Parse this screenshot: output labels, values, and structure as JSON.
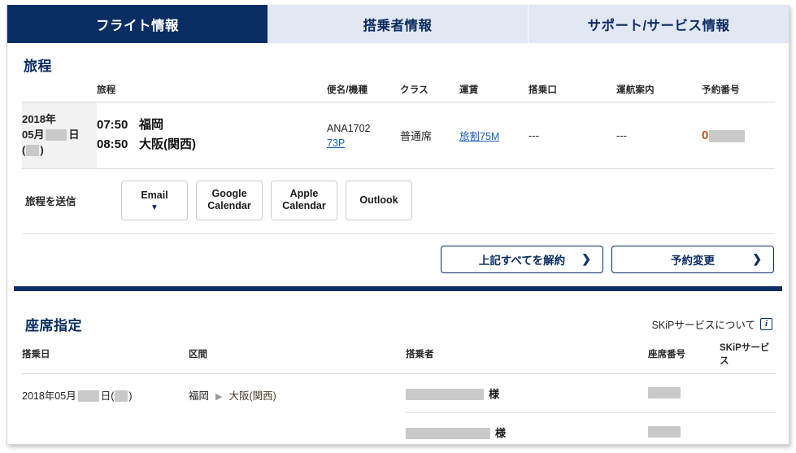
{
  "tabs": [
    {
      "label": "フライト情報",
      "active": true
    },
    {
      "label": "搭乗者情報",
      "active": false
    },
    {
      "label": "サポート/サービス情報",
      "active": false
    }
  ],
  "itinerary": {
    "section_title": "旅程",
    "columns": [
      "旅程",
      "便名/機種",
      "クラス",
      "運賃",
      "搭乗口",
      "運航案内",
      "予約番号"
    ],
    "row": {
      "date_year": "2018年",
      "date_month": "05月",
      "date_day_suffix": "日",
      "dow_open": "(",
      "dow_close": ")",
      "depart_time": "07:50",
      "depart_city": "福岡",
      "arrive_time": "08:50",
      "arrive_city": "大阪(関西)",
      "flight_number": "ANA1702",
      "aircraft": "73P",
      "cabin_class": "普通席",
      "fare": "旅割75M",
      "gate": "---",
      "operation": "---",
      "booking_prefix": "0"
    }
  },
  "send_itinerary": {
    "label": "旅程を送信",
    "buttons": [
      {
        "line1": "Email",
        "line2": "",
        "caret": "▼"
      },
      {
        "line1": "Google",
        "line2": "Calendar",
        "caret": ""
      },
      {
        "line1": "Apple",
        "line2": "Calendar",
        "caret": ""
      },
      {
        "line1": "Outlook",
        "line2": "",
        "caret": ""
      }
    ]
  },
  "actions": [
    {
      "label": "上記すべてを解約",
      "chevron": "❯"
    },
    {
      "label": "予約変更",
      "chevron": "❯"
    }
  ],
  "seats": {
    "section_title": "座席指定",
    "skip_link_label": "SKiPサービスについて",
    "info_icon_glyph": "i",
    "columns": [
      "搭乗日",
      "区間",
      "搭乗者",
      "座席番号",
      "SKiPサービス"
    ],
    "row": {
      "date_prefix": "2018年05月",
      "date_day_suffix": "日",
      "dow_open": "(",
      "dow_close": ")",
      "origin": "福岡",
      "arrow": "▶",
      "destination": "大阪(関西)"
    },
    "passengers": [
      {
        "honorific": "様"
      },
      {
        "honorific": "様"
      }
    ]
  },
  "colors": {
    "navy": "#0a2d63",
    "tab_inactive_bg": "#e2e7f4",
    "link_blue": "#1a5eb8",
    "booking_orange": "#cc4b13",
    "row_gray": "#f2f2f2"
  }
}
